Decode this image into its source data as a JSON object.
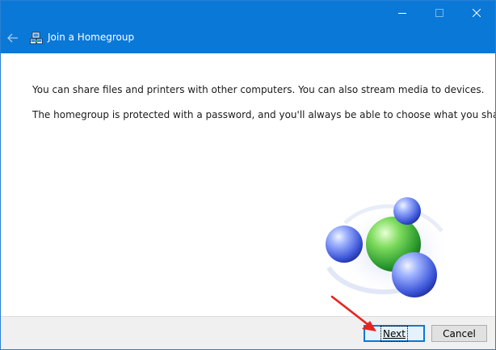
{
  "window": {
    "title": "Join a Homegroup"
  },
  "titlebar": {
    "back_icon": "back-arrow-icon",
    "app_icon": "homegroup-icon",
    "controls": [
      "minimize-icon",
      "maximize-icon",
      "close-icon"
    ]
  },
  "content": {
    "paragraph1": "You can share files and printers with other computers. You can also stream media to devices.",
    "paragraph2": "The homegroup is protected with a password, and you'll always be able to choose what you share."
  },
  "footer": {
    "next_label": "Next",
    "cancel_label": "Cancel"
  },
  "annotation": {
    "arrow_color": "#e8231e"
  },
  "colors": {
    "titlebar": "#0a78d7",
    "footer": "#f0f0f0",
    "focused_button_border": "#0a78d7"
  }
}
